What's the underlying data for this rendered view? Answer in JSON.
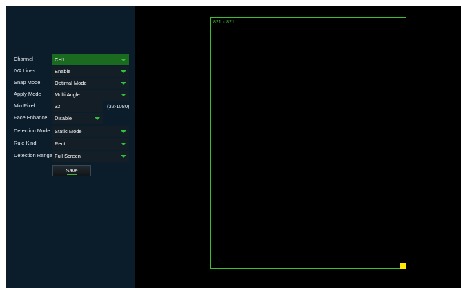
{
  "settings": {
    "channel": {
      "label": "Channel",
      "value": "CH1"
    },
    "iva_lines": {
      "label": "IVA Lines",
      "value": "Enable"
    },
    "snap_mode": {
      "label": "Snap Mode",
      "value": "Optimal Mode"
    },
    "apply_mode": {
      "label": "Apply Mode",
      "value": "Multi Angle"
    },
    "min_pixel": {
      "label": "Min Pixel",
      "value": "32",
      "range": "(32-1080)"
    },
    "face_enhance": {
      "label": "Face Enhance",
      "value": "Disable"
    },
    "detection_mode": {
      "label": "Detection Mode",
      "value": "Static Mode"
    },
    "rule_kind": {
      "label": "Rule Kind",
      "value": "Rect"
    },
    "detection_range": {
      "label": "Detection Range",
      "value": "Full Screen"
    },
    "save_label": "Save"
  },
  "preview": {
    "area_size": "821 x 821"
  },
  "colors": {
    "panel_bg": "#0b1c2a",
    "accent_green": "#3bbf2f",
    "handle_yellow": "#ffea00"
  }
}
